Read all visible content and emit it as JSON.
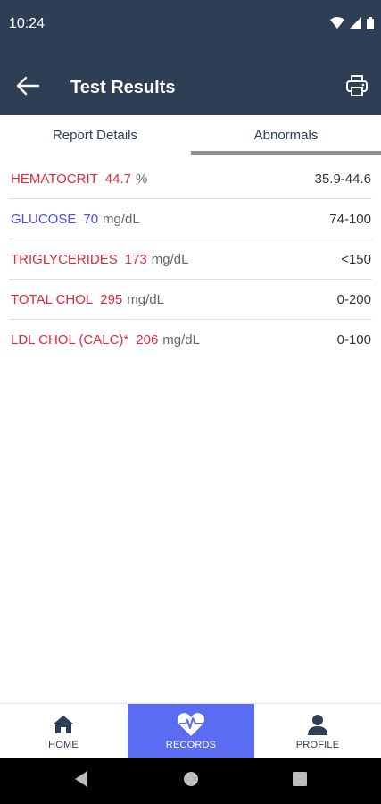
{
  "status_bar": {
    "time": "10:24",
    "icons": [
      "wifi-icon",
      "signal-icon",
      "battery-icon"
    ]
  },
  "app_bar": {
    "title": "Test Results",
    "back_icon": "arrow-left-icon",
    "print_icon": "printer-icon"
  },
  "tabs": [
    {
      "label": "Report Details",
      "active": false
    },
    {
      "label": "Abnormals",
      "active": true
    }
  ],
  "results": [
    {
      "name": "HEMATOCRIT",
      "value": "44.7",
      "unit": "%",
      "range": "35.9-44.6",
      "color": "#e8283a"
    },
    {
      "name": "GLUCOSE",
      "value": "70",
      "unit": "mg/dL",
      "range": "74-100",
      "color": "#4a4af0"
    },
    {
      "name": "TRIGLYCERIDES",
      "value": "173",
      "unit": "mg/dL",
      "range": "<150",
      "color": "#e8283a"
    },
    {
      "name": "TOTAL CHOL",
      "value": "295",
      "unit": "mg/dL",
      "range": "0-200",
      "color": "#e8283a"
    },
    {
      "name": "LDL CHOL (CALC)*",
      "value": "206",
      "unit": "mg/dL",
      "range": "0-100",
      "color": "#e8283a"
    }
  ],
  "bottom_nav": [
    {
      "label": "HOME",
      "icon": "home-icon",
      "active": false
    },
    {
      "label": "RECORDS",
      "icon": "heart-pulse-icon",
      "active": true
    },
    {
      "label": "PROFILE",
      "icon": "person-icon",
      "active": false
    }
  ],
  "colors": {
    "header": "#2e3e55",
    "accent": "#5a6cf2",
    "high": "#e8283a",
    "low": "#4a4af0"
  }
}
